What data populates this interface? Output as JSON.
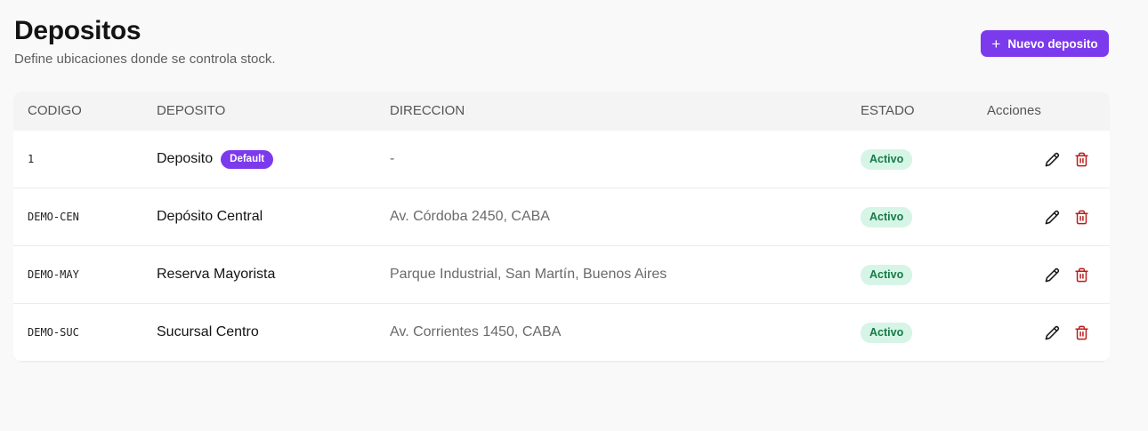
{
  "header": {
    "title": "Depositos",
    "subtitle": "Define ubicaciones donde se controla stock.",
    "new_button": {
      "icon": "plus-icon",
      "label": "Nuevo deposito"
    }
  },
  "table": {
    "columns": [
      "CODIGO",
      "DEPOSITO",
      "DIRECCION",
      "ESTADO",
      "Acciones"
    ],
    "rows": [
      {
        "code": "1",
        "name": "Deposito",
        "badge": "Default",
        "address": "-",
        "status": "Activo"
      },
      {
        "code": "DEMO-CEN",
        "name": "Depósito Central",
        "badge": "",
        "address": "Av. Córdoba 2450, CABA",
        "status": "Activo"
      },
      {
        "code": "DEMO-MAY",
        "name": "Reserva Mayorista",
        "badge": "",
        "address": "Parque Industrial, San Martín, Buenos Aires",
        "status": "Activo"
      },
      {
        "code": "DEMO-SUC",
        "name": "Sucursal Centro",
        "badge": "",
        "address": "Av. Corrientes 1450, CABA",
        "status": "Activo"
      }
    ],
    "row_actions": [
      "edit-icon",
      "trash-icon"
    ]
  },
  "colors": {
    "accent": "#7c3aed",
    "status_bg": "#d6f5e6",
    "status_text": "#177a47",
    "delete": "#b91c1c"
  }
}
